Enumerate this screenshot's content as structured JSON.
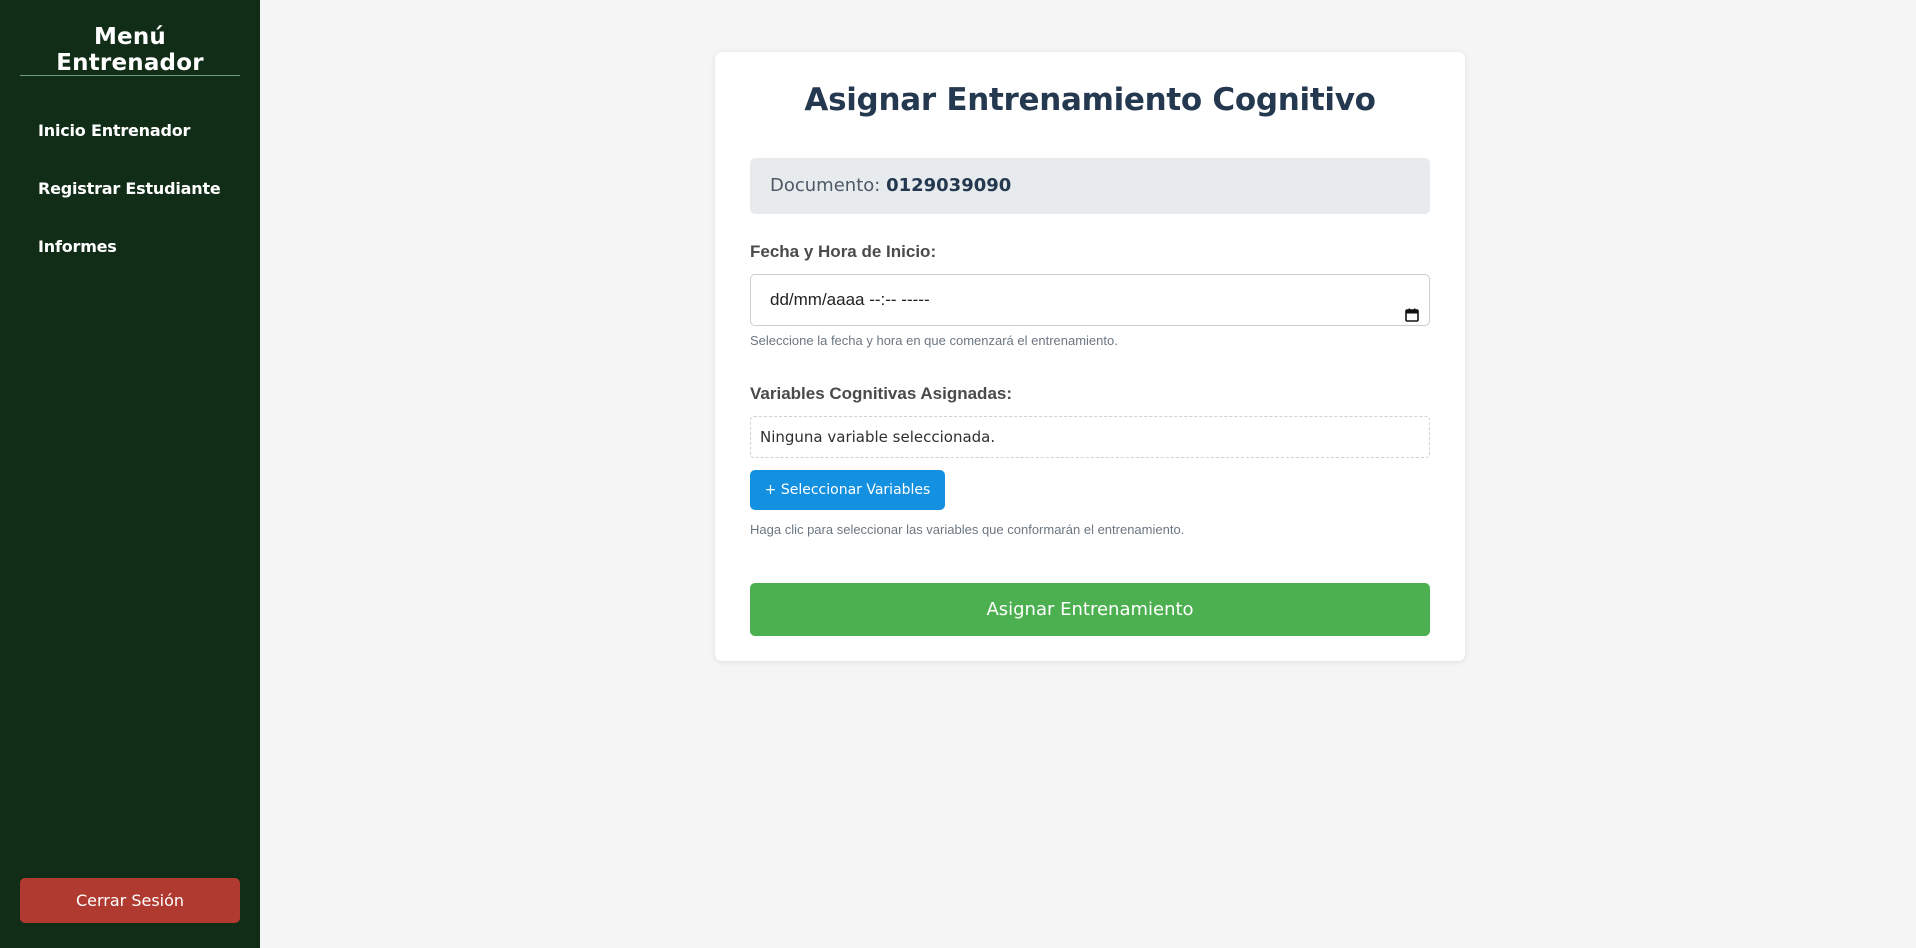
{
  "sidebar": {
    "title": "Menú Entrenador",
    "items": [
      {
        "label": "Inicio Entrenador"
      },
      {
        "label": "Registrar Estudiante"
      },
      {
        "label": "Informes"
      }
    ],
    "logout_label": "Cerrar Sesión",
    "background_color": "#122d17",
    "logout_color": "#b03a30"
  },
  "form": {
    "title": "Asignar Entrenamiento Cognitivo",
    "document": {
      "label": "Documento:",
      "value": "0129039090"
    },
    "start_datetime": {
      "label": "Fecha y Hora de Inicio:",
      "placeholder": "dd/mm/aaaa --:-- -----",
      "icon": "calendar-icon",
      "hint": "Seleccione la fecha y hora en que comenzará el entrenamiento."
    },
    "variables": {
      "label": "Variables Cognitivas Asignadas:",
      "empty_text": "Ninguna variable seleccionada.",
      "select_button_label": "+ Seleccionar Variables",
      "hint": "Haga clic para seleccionar las variables que conformarán el entrenamiento."
    },
    "submit_label": "Asignar Entrenamiento",
    "submit_color": "#4cb050",
    "select_button_color": "#1490e0"
  }
}
